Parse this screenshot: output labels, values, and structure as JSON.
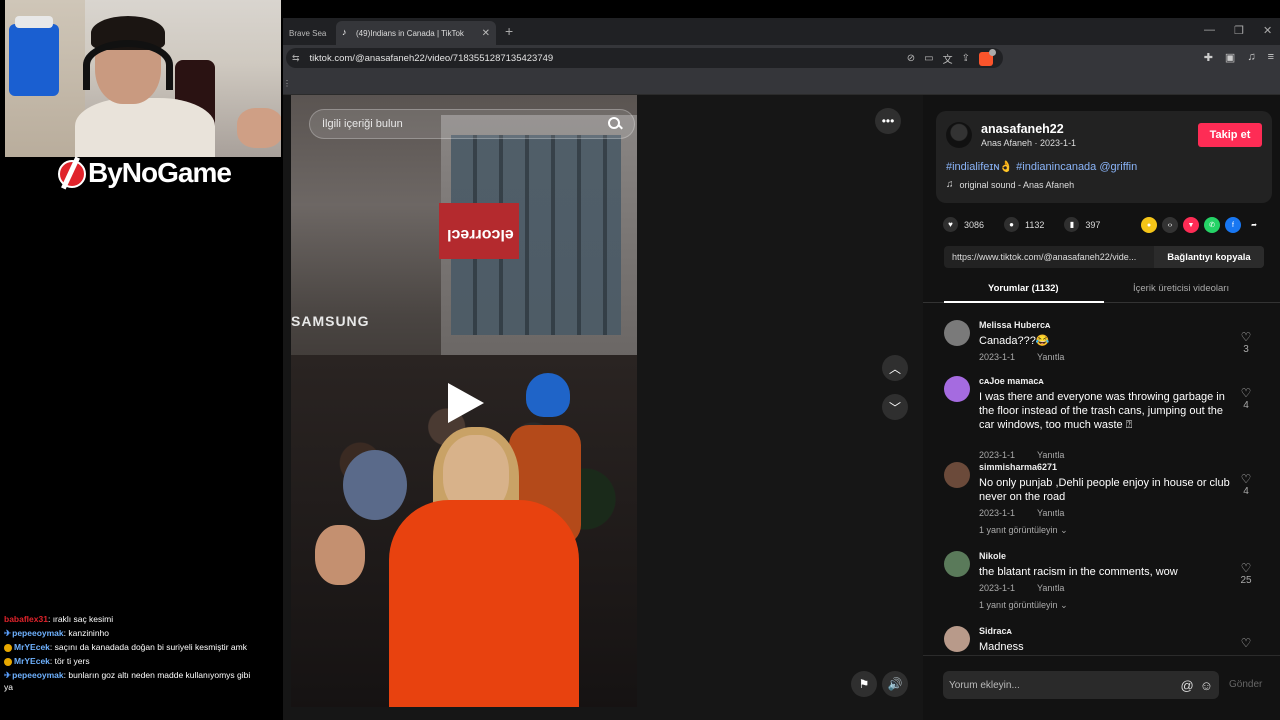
{
  "overlay": {
    "brand": "ByNoGame",
    "chat": [
      {
        "user": "babaflex31",
        "color": "#e0232b",
        "text": "ıraklı saç kesimi",
        "badge": "none"
      },
      {
        "user": "pepeeoymak",
        "color": "#6fb2ff",
        "text": "kanzininho",
        "badge": "pin"
      },
      {
        "user": "MrYEcek",
        "color": "#6fb2ff",
        "text": "saçını da kanadada doğan bi suriyeli kesmiştir amk",
        "badge": "dot"
      },
      {
        "user": "MrYEcek",
        "color": "#6fb2ff",
        "text": "tör ti yers",
        "badge": "dot"
      },
      {
        "user": "pepeeoymak",
        "color": "#6fb2ff",
        "text": "bunların goz altı neden madde kullanıyomys gibi ya",
        "badge": "pin"
      }
    ]
  },
  "browser": {
    "prev_tab": "Brave Sea",
    "active_tab": "(49)Indians in Canada | TikTok",
    "url": "tiktok.com/@anasafaneh22/video/7183551287135423749"
  },
  "video": {
    "search_placeholder": "İlgili içeriği bulun",
    "sign_text": "elcorrecl",
    "samsung_text": "SAMSUNG",
    "more": "•••"
  },
  "post": {
    "username": "anasafaneh22",
    "sub": "Anas Afaneh · 2023-1-1",
    "follow": "Takip et",
    "tags": "#indialifeɪɴ👌 #indianincanada @griffin",
    "sound": "original sound - Anas Afaneh",
    "likes": "3086",
    "comments": "1132",
    "saves": "397",
    "link": "https://www.tiktok.com/@anasafaneh22/vide...",
    "copy_link": "Bağlantıyı kopyala",
    "tab_comments": "Yorumlar (1132)",
    "tab_creator": "İçerik üreticisi videoları"
  },
  "comments": [
    {
      "user": "Melissa Huberᴄᴀ",
      "text": "Canada???😂",
      "date": "2023-1-1",
      "reply": "Yanıtla",
      "likes": "3",
      "avatar": "#7a7a7a"
    },
    {
      "user": "ᴄᴀJoe mamaᴄᴀ",
      "text": "I was there and everyone was throwing garbage in the floor instead of the trash cans, jumping out the car windows, too much waste ⍰",
      "date": "2023-1-1",
      "reply": "Yanıtla",
      "likes": "4",
      "avatar": "#a56be0"
    },
    {
      "user": "simmisharma6271",
      "text": "No only punjab ,Dehli people enjoy in house or club never on the road",
      "date": "2023-1-1",
      "reply": "Yanıtla",
      "likes": "4",
      "avatar": "#6b4a3a",
      "replies": "1 yanıt görüntüleyin"
    },
    {
      "user": "Nikole",
      "text": "the blatant racism in the comments, wow",
      "date": "2023-1-1",
      "reply": "Yanıtla",
      "likes": "25",
      "avatar": "#5a7a5a",
      "replies": "1 yanıt görüntüleyin"
    },
    {
      "user": "Sidraᴄᴀ",
      "text": "Madness",
      "date": "",
      "reply": "",
      "likes": "",
      "avatar": "#b89a8a"
    }
  ],
  "compose": {
    "placeholder": "Yorum ekleyin...",
    "send": "Gönder"
  },
  "colors": {
    "tiktok_red": "#fe2c55",
    "hashtag_blue": "#8ab4f8",
    "brave_orange": "#fb542b"
  }
}
